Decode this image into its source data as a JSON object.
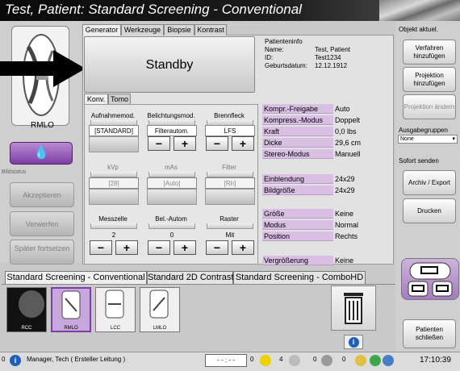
{
  "window": {
    "title": "Test, Patient:  Standard Screening - Conventional"
  },
  "left": {
    "view_label": "RMLO",
    "bildstatus_label": "Bildstatus",
    "accept_label": "Akzeptieren",
    "reject_label": "Verwerfen",
    "later_label": "Später fortsetzen"
  },
  "generator_tabs": [
    "Generator",
    "Werkzeuge",
    "Biopsie",
    "Kontrast"
  ],
  "standby_label": "Standby",
  "patient_info": {
    "header": "Patienteninfo",
    "name_label": "Name:",
    "name_value": "Test, Patient",
    "id_label": "ID:",
    "id_value": "Test1234",
    "dob_label": "Geburtsdatum:",
    "dob_value": "12.12.1912"
  },
  "sub_tabs": [
    "Konv.",
    "Tomo"
  ],
  "controls": [
    {
      "label": "Aufnahmemod.",
      "value": "[STANDARD]",
      "grey": false
    },
    {
      "label": "Belichtungsmod.",
      "value": "Filterautom.",
      "grey": false
    },
    {
      "label": "Brennfleck",
      "value": "LFS",
      "grey": false
    },
    {
      "label": "kVp",
      "value": "[28]",
      "grey": true
    },
    {
      "label": "mAs",
      "value": "[Auto]",
      "grey": true
    },
    {
      "label": "Filter",
      "value": "[Rh]",
      "grey": true
    },
    {
      "label": "Messzelle",
      "value": "2",
      "grey": false
    },
    {
      "label": "Bel.-Autom",
      "value": "0",
      "grey": false
    },
    {
      "label": "Raster",
      "value": "Mit",
      "grey": false
    }
  ],
  "minus": "−",
  "plus": "+",
  "properties": [
    {
      "label": "Kompr.-Freigabe",
      "value": "Auto"
    },
    {
      "label": "Kompress.-Modus",
      "value": "Doppelt"
    },
    {
      "label": "Kraft",
      "value": "0,0 lbs"
    },
    {
      "label": "Dicke",
      "value": "29,6 cm"
    },
    {
      "label": "Stereo-Modus",
      "value": "Manuell"
    },
    {
      "label": "Einblendung",
      "value": "24x29"
    },
    {
      "label": "Bildgröße",
      "value": "24x29"
    },
    {
      "label": "Größe",
      "value": "Keine"
    },
    {
      "label": "Modus",
      "value": "Normal"
    },
    {
      "label": "Position",
      "value": "Rechts"
    },
    {
      "label": "Vergrößerung",
      "value": "Keine"
    }
  ],
  "right": {
    "header": "Objekt aktuel.",
    "add_procedure": "Verfahren hinzufügen",
    "add_projection": "Projektion hinzufügen",
    "change_projection": "Projektion ändern",
    "output_groups": "Ausgabegruppen",
    "output_select": "None",
    "send_now": "Sofort senden",
    "archive_export": "Archiv / Export",
    "print": "Drucken",
    "close_patient": "Patienten schließen"
  },
  "procedure_tabs": [
    "Standard Screening - Conventional",
    "Standard 2D Contrast",
    "Standard Screening - ComboHD"
  ],
  "thumbnails": [
    "RCC",
    "RMLO",
    "LCC",
    "LMLO"
  ],
  "status": {
    "left_count": "0",
    "user": "Manager, Tech ( Ersteller Leitung )",
    "timer": "- - : - -",
    "c1": "0",
    "c2": "4",
    "c3": "0",
    "c4": "0",
    "time": "17:10:39"
  },
  "colors": {
    "accent": "#8a4fb4",
    "label_bg": "#d9bfe3",
    "titlebar": "#111111"
  }
}
